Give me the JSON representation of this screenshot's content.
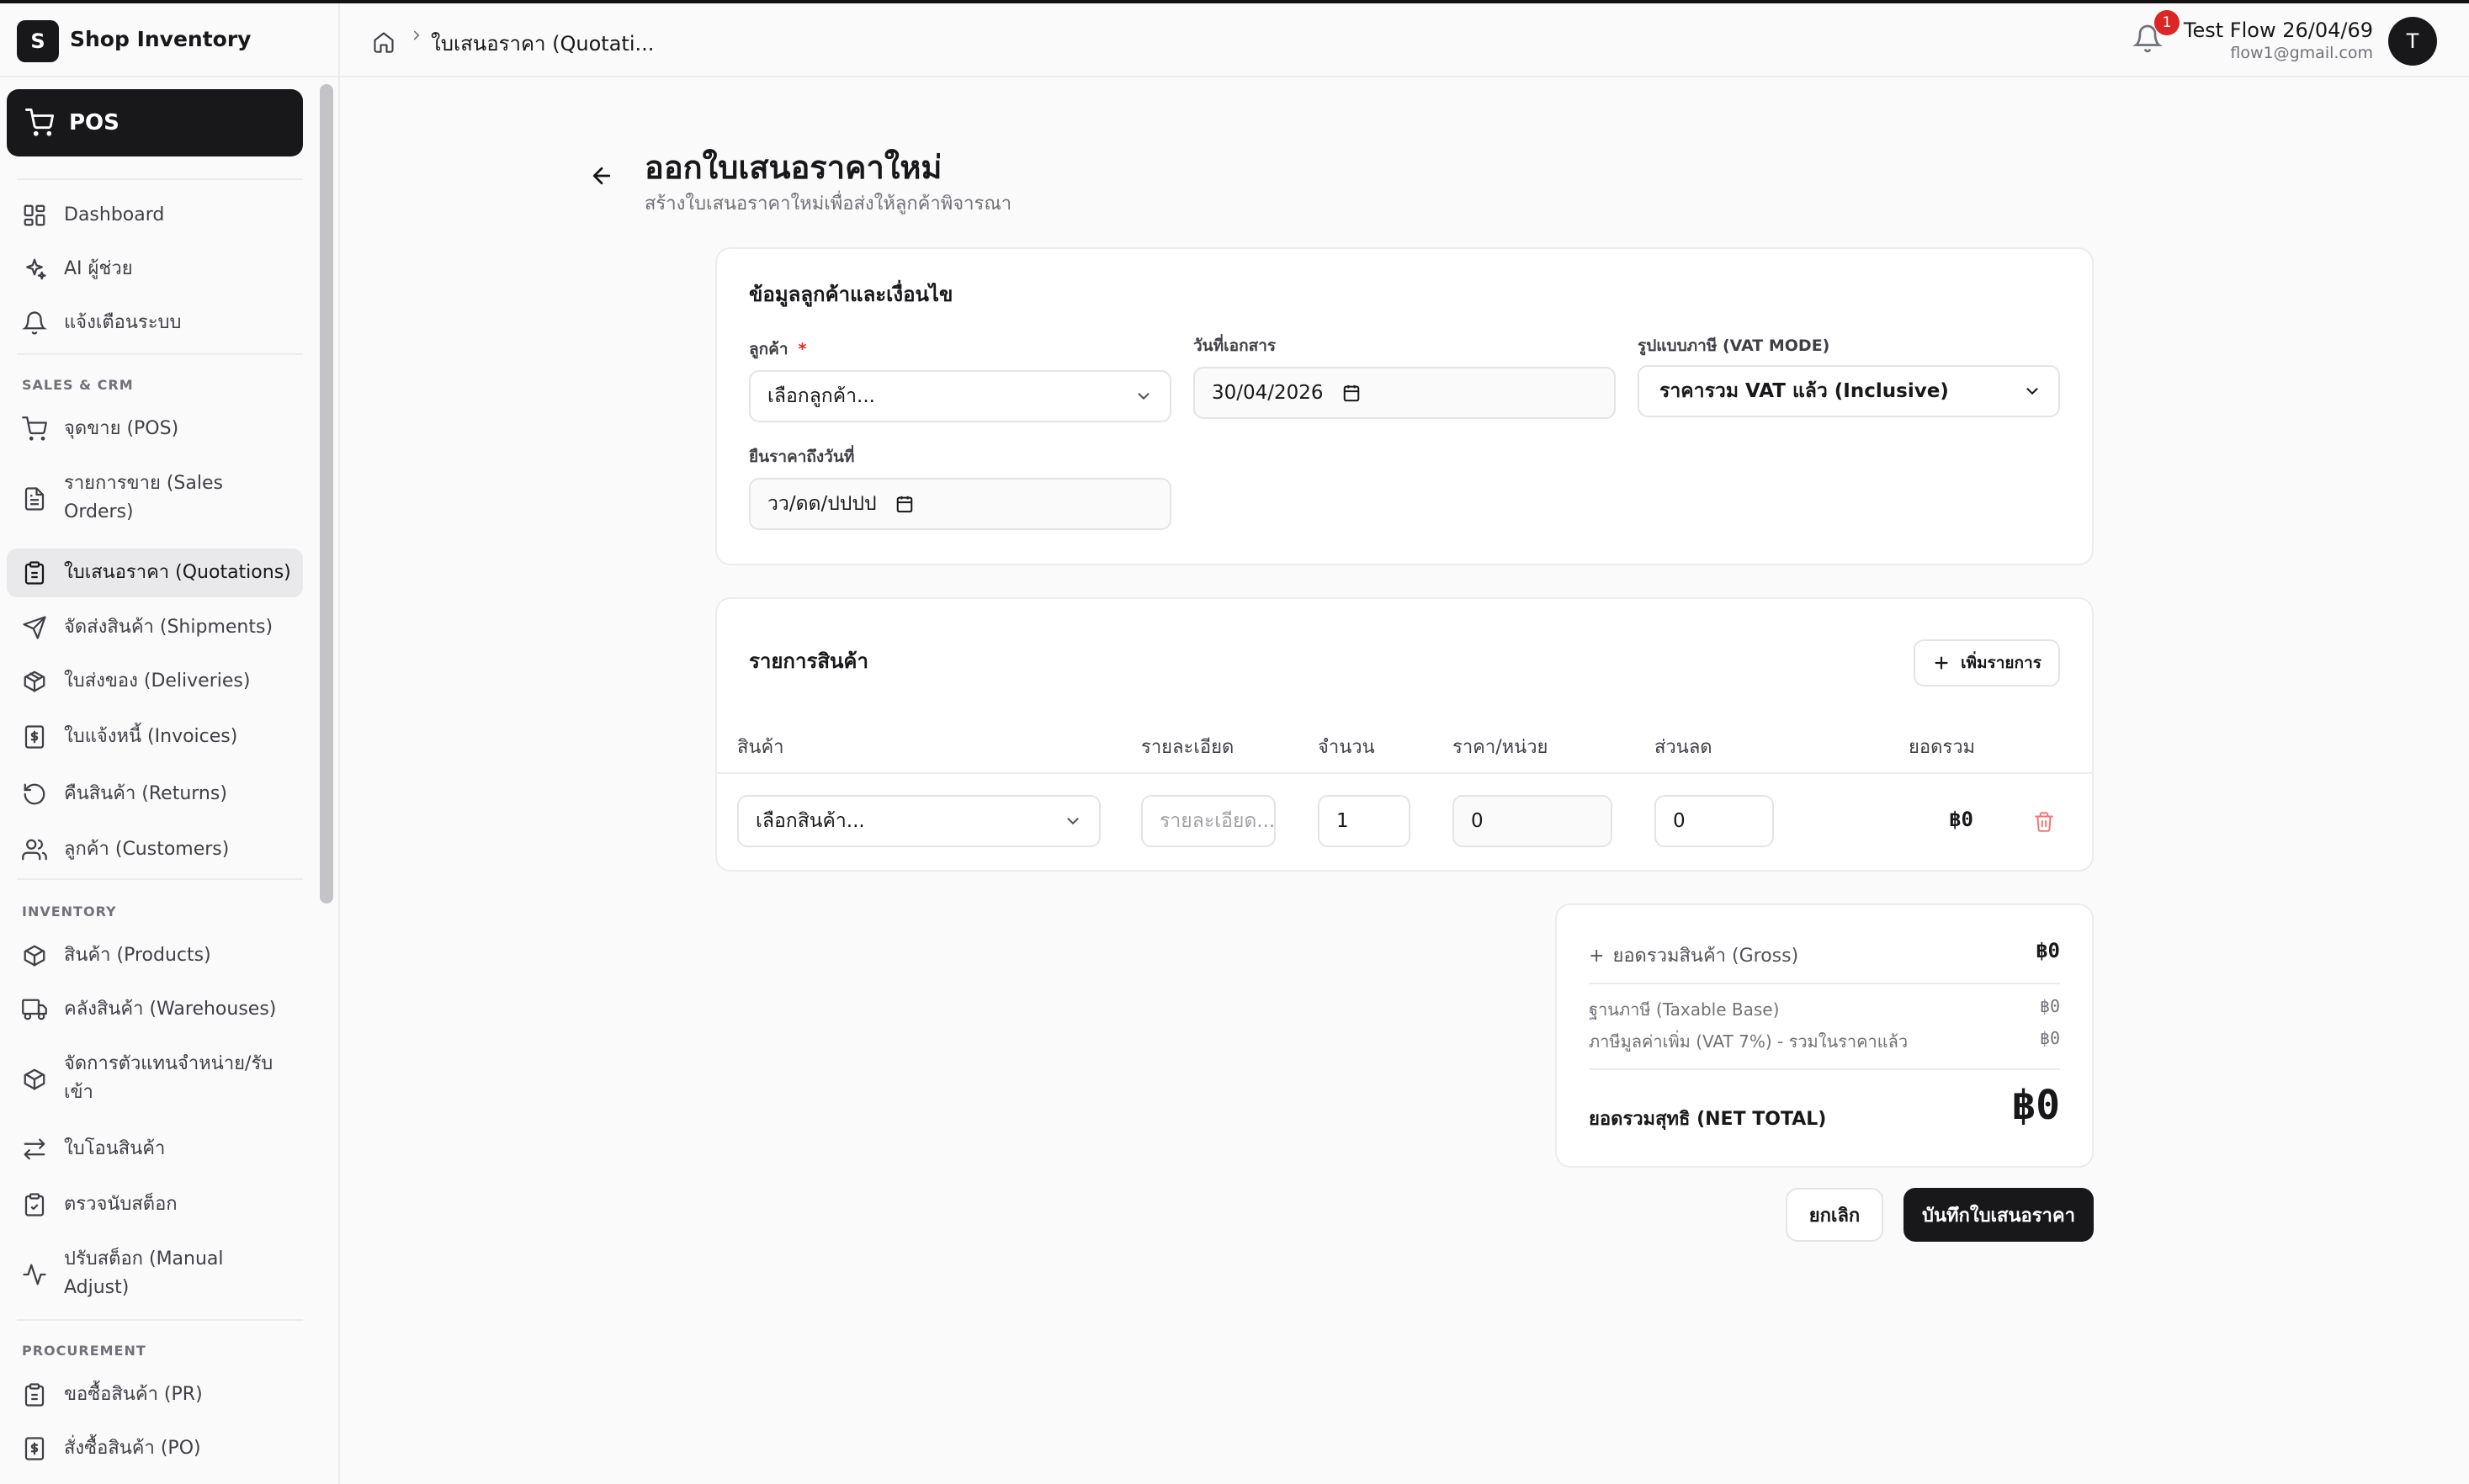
{
  "app": {
    "logo_letter": "S",
    "name": "Shop Inventory"
  },
  "sidebar": {
    "pos_label": "POS",
    "items_top": [
      {
        "label": "Dashboard",
        "icon": "dashboard-icon"
      },
      {
        "label": "AI ผู้ช่วย",
        "icon": "sparkles-icon"
      },
      {
        "label": "แจ้งเตือนระบบ",
        "icon": "bell-icon"
      }
    ],
    "section_sales": "SALES & CRM",
    "items_sales": [
      {
        "label": "จุดขาย (POS)",
        "icon": "cart-icon"
      },
      {
        "label": "รายการขาย (Sales Orders)",
        "icon": "file-text-icon"
      },
      {
        "label": "ใบเสนอราคา (Quotations)",
        "icon": "clipboard-icon"
      },
      {
        "label": "จัดส่งสินค้า (Shipments)",
        "icon": "send-icon"
      },
      {
        "label": "ใบส่งของ (Deliveries)",
        "icon": "package-icon"
      },
      {
        "label": "ใบแจ้งหนี้ (Invoices)",
        "icon": "receipt-icon"
      },
      {
        "label": "คืนสินค้า (Returns)",
        "icon": "rotate-icon"
      },
      {
        "label": "ลูกค้า (Customers)",
        "icon": "users-icon"
      }
    ],
    "section_inventory": "INVENTORY",
    "items_inventory": [
      {
        "label": "สินค้า (Products)",
        "icon": "package-icon"
      },
      {
        "label": "คลังสินค้า (Warehouses)",
        "icon": "truck-icon"
      },
      {
        "label": "จัดการตัวแทนจำหน่าย/รับเข้า",
        "icon": "package-icon"
      },
      {
        "label": "ใบโอนสินค้า",
        "icon": "transfer-icon"
      },
      {
        "label": "ตรวจนับสต็อก",
        "icon": "clipboard-check-icon"
      },
      {
        "label": "ปรับสต็อก (Manual Adjust)",
        "icon": "activity-icon"
      }
    ],
    "section_procurement": "PROCUREMENT",
    "items_procurement": [
      {
        "label": "ขอซื้อสินค้า (PR)",
        "icon": "clipboard-icon"
      },
      {
        "label": "สั่งซื้อสินค้า (PO)",
        "icon": "receipt-icon"
      }
    ]
  },
  "header": {
    "breadcrumb": "ใบเสนอราคา (Quotati...",
    "notification_count": "1",
    "user_name": "Test Flow 26/04/69",
    "user_email": "flow1@gmail.com",
    "avatar_letter": "T"
  },
  "page": {
    "title": "ออกใบเสนอราคาใหม่",
    "subtitle": "สร้างใบเสนอราคาใหม่เพื่อส่งให้ลูกค้าพิจารณา"
  },
  "customer_card": {
    "title": "ข้อมูลลูกค้าและเงื่อนไข",
    "customer_label": "ลูกค้า",
    "customer_required": "*",
    "customer_placeholder": "เลือกลูกค้า...",
    "doc_date_label": "วันที่เอกสาร",
    "doc_date_value": "30/04/2026",
    "vat_label": "รูปแบบภาษี (VAT MODE)",
    "vat_value": "ราคารวม VAT แล้ว (Inclusive)",
    "valid_until_label": "ยืนราคาถึงวันที่",
    "valid_until_placeholder": "วว/ดด/ปปปป"
  },
  "items_card": {
    "title": "รายการสินค้า",
    "add_button": "เพิ่มรายการ",
    "columns": [
      "สินค้า",
      "รายละเอียด",
      "จำนวน",
      "ราคา/หน่วย",
      "ส่วนลด",
      "ยอดรวม"
    ],
    "row": {
      "product_placeholder": "เลือกสินค้า...",
      "detail_placeholder": "รายละเอียด...",
      "quantity": "1",
      "unit_price": "0",
      "discount": "0",
      "total": "฿0"
    }
  },
  "summary": {
    "gross_label": "ยอดรวมสินค้า (Gross)",
    "gross_value": "฿0",
    "taxable_label": "ฐานภาษี (Taxable Base)",
    "taxable_value": "฿0",
    "vat_label": "ภาษีมูลค่าเพิ่ม (VAT 7%) - รวมในราคาแล้ว",
    "vat_value": "฿0",
    "net_label": "ยอดรวมสุทธิ (NET TOTAL)",
    "net_value": "฿0"
  },
  "actions": {
    "cancel": "ยกเลิก",
    "save": "บันทึกใบเสนอราคา"
  }
}
